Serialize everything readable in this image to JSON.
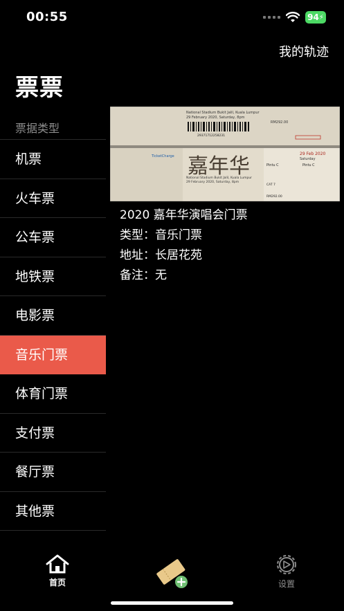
{
  "status_bar": {
    "time": "00:55",
    "battery": "94"
  },
  "header": {
    "track_link": "我的轨迹",
    "title": "票票"
  },
  "sidebar": {
    "heading": "票据类型",
    "items": [
      {
        "label": "机票"
      },
      {
        "label": "火车票"
      },
      {
        "label": "公车票"
      },
      {
        "label": "地铁票"
      },
      {
        "label": "电影票"
      },
      {
        "label": "音乐门票",
        "active": true
      },
      {
        "label": "体育门票"
      },
      {
        "label": "支付票"
      },
      {
        "label": "餐厅票"
      },
      {
        "label": "其他票"
      }
    ]
  },
  "ticket": {
    "title": "2020 嘉年华演唱会门票",
    "type_line": "类型：音乐门票",
    "address_line": "地址：长居花苑",
    "note_line": "备注：无",
    "image_text": {
      "headline": "嘉年华",
      "venue": "National Stadium Bukit Jalil, Kuala Lumpur",
      "date": "29 February 2020, Saturday, 8pm",
      "barcode_number": "29371712258231",
      "side_date": "29 Feb 2020",
      "side_day": "Saturday",
      "zone": "Pintu C",
      "cat": "CAT 7",
      "price": "RM292.00",
      "brand": "TicketCharge"
    }
  },
  "tab_bar": {
    "home_label": "首页",
    "settings_label": "设置"
  },
  "colors": {
    "accent": "#ea5a4a",
    "background": "#000000",
    "battery": "#4cd964"
  }
}
